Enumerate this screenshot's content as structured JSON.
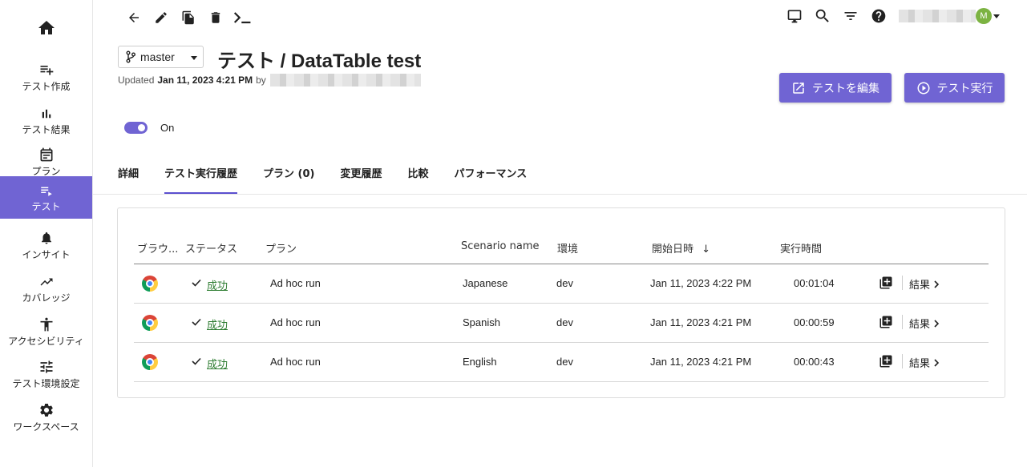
{
  "sidebar": {
    "items": [
      {
        "label": "テスト作成",
        "icon": "playlist-add-icon"
      },
      {
        "label": "テスト結果",
        "icon": "bar-chart-icon"
      },
      {
        "label": "プラン",
        "icon": "calendar-icon"
      },
      {
        "label": "テスト",
        "icon": "list-play-icon",
        "active": true
      },
      {
        "label": "インサイト",
        "icon": "bell-icon"
      },
      {
        "label": "カバレッジ",
        "icon": "trending-up-icon"
      },
      {
        "label": "アクセシビリティ",
        "icon": "accessibility-icon"
      },
      {
        "label": "テスト環境設定",
        "icon": "tune-icon"
      },
      {
        "label": "ワークスペース",
        "icon": "gear-icon"
      }
    ]
  },
  "toolbar": {
    "icons": [
      "back-arrow-icon",
      "pencil-icon",
      "copy-icon",
      "trash-icon",
      "terminal-icon"
    ]
  },
  "top_right": {
    "icons": [
      "monitor-icon",
      "search-icon",
      "filter-icon",
      "help-icon"
    ],
    "avatar_initial": "M"
  },
  "header": {
    "branch": "master",
    "title": "テスト / DataTable test",
    "updated_prefix": "Updated",
    "updated_date": "Jan 11, 2023 4:21 PM",
    "updated_by": "by",
    "edit_button": "テストを編集",
    "run_button": "テスト実行",
    "toggle_label": "On"
  },
  "tabs": [
    {
      "label": "詳細"
    },
    {
      "label": "テスト実行履歴",
      "active": true
    },
    {
      "label": "プラン (0)"
    },
    {
      "label": "変更履歴"
    },
    {
      "label": "比較"
    },
    {
      "label": "パフォーマンス"
    }
  ],
  "table": {
    "columns": {
      "browser": "ブラウ...",
      "status": "ステータス",
      "plan": "プラン",
      "scenario": "Scenario name",
      "env": "環境",
      "start": "開始日時",
      "duration": "実行時間"
    },
    "sort_indicator": "↓",
    "rows": [
      {
        "status": "成功",
        "plan": "Ad hoc run",
        "scenario": "Japanese",
        "env": "dev",
        "start": "Jan 11, 2023 4:22 PM",
        "duration": "00:01:04",
        "result": "結果"
      },
      {
        "status": "成功",
        "plan": "Ad hoc run",
        "scenario": "Spanish",
        "env": "dev",
        "start": "Jan 11, 2023 4:21 PM",
        "duration": "00:00:59",
        "result": "結果"
      },
      {
        "status": "成功",
        "plan": "Ad hoc run",
        "scenario": "English",
        "env": "dev",
        "start": "Jan 11, 2023 4:21 PM",
        "duration": "00:00:43",
        "result": "結果"
      }
    ]
  },
  "colors": {
    "accent": "#7064d3",
    "success": "#2e7d32",
    "avatar": "#7cb342"
  }
}
